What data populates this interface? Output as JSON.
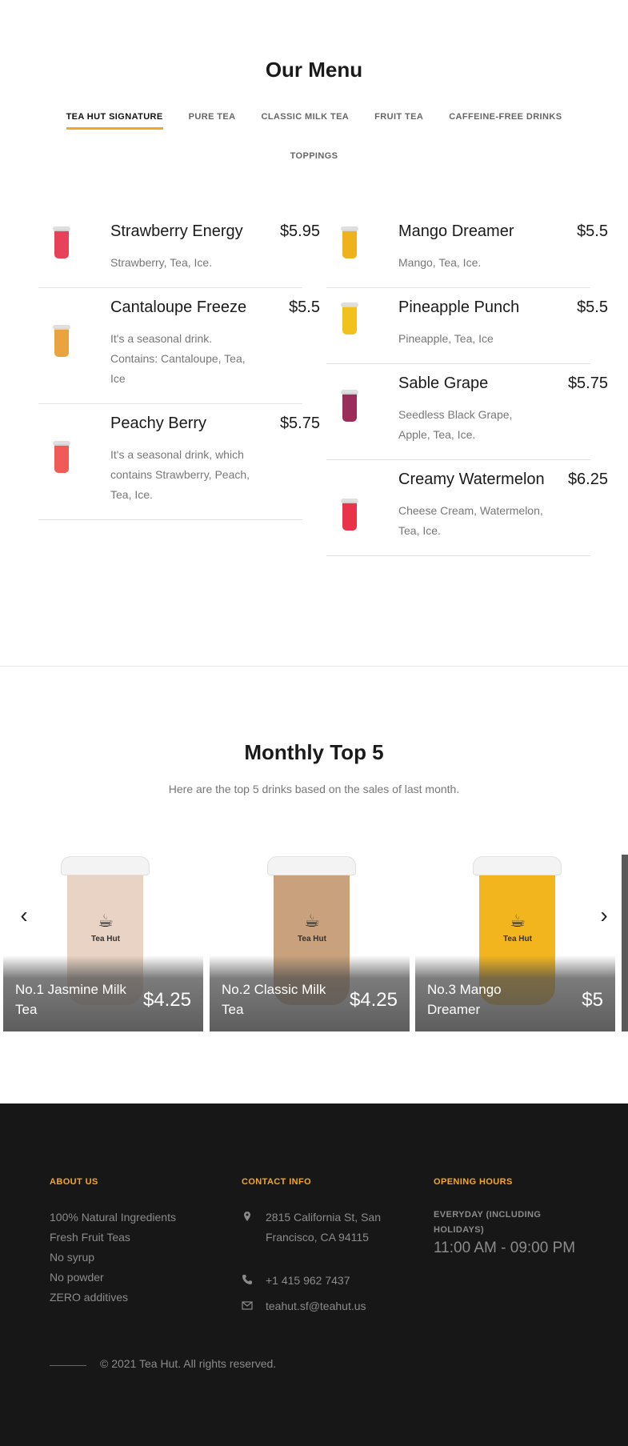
{
  "menu": {
    "title": "Our Menu",
    "tabs": [
      {
        "label": "TEA HUT SIGNATURE",
        "active": true
      },
      {
        "label": "PURE TEA"
      },
      {
        "label": "CLASSIC MILK TEA"
      },
      {
        "label": "FRUIT TEA"
      },
      {
        "label": "CAFFEINE-FREE DRINKS"
      },
      {
        "label": "TOPPINGS"
      }
    ],
    "left": [
      {
        "name": "Strawberry Energy",
        "price": "$5.95",
        "desc": "Strawberry, Tea, Ice.",
        "color": "#e8425a"
      },
      {
        "name": "Cantaloupe Freeze",
        "price": "$5.5",
        "desc": "It's a seasonal drink. Contains: Cantaloupe, Tea, Ice",
        "color": "#e9a33f"
      },
      {
        "name": "Peachy Berry",
        "price": "$5.75",
        "desc": "It's a seasonal drink, which contains Strawberry, Peach, Tea, Ice.",
        "color": "#f05a57"
      }
    ],
    "right": [
      {
        "name": "Mango Dreamer",
        "price": "$5.5",
        "desc": "Mango, Tea, Ice.",
        "color": "#f0b21a"
      },
      {
        "name": "Pineapple Punch",
        "price": "$5.5",
        "desc": "Pineapple, Tea, Ice",
        "color": "#f2c21c"
      },
      {
        "name": "Sable Grape",
        "price": "$5.75",
        "desc": "Seedless Black Grape, Apple, Tea, Ice.",
        "color": "#9b2d5a"
      },
      {
        "name": "Creamy Watermelon",
        "price": "$6.25",
        "desc": "Cheese Cream, Watermelon, Tea, Ice.",
        "color": "#e83348"
      }
    ]
  },
  "top5": {
    "title": "Monthly Top 5",
    "subtitle": "Here are the top 5 drinks based on the sales of last month.",
    "cards": [
      {
        "name": "No.1 Jasmine Milk Tea",
        "price": "$4.25",
        "color": "#e9d3c4"
      },
      {
        "name": "No.2 Classic Milk Tea",
        "price": "$4.25",
        "color": "#c9a27d"
      },
      {
        "name": "No.3 Mango Dreamer",
        "price": "$5",
        "color": "#f2b51d"
      }
    ],
    "prev_icon": "chevron-left-icon",
    "next_icon": "chevron-right-icon"
  },
  "footer": {
    "about": {
      "heading": "ABOUT US",
      "items": [
        "100% Natural Ingredients",
        "Fresh Fruit Teas",
        "No syrup",
        "No powder",
        "ZERO additives"
      ]
    },
    "contact": {
      "heading": "CONTACT INFO",
      "address": "2815 California St, San Francisco, CA 94115",
      "phone": "+1 415 962 7437",
      "email": "teahut.sf@teahut.us"
    },
    "hours": {
      "heading": "OPENING HOURS",
      "label": "EVERYDAY (INCLUDING HOLIDAYS)",
      "time": "11:00 AM - 09:00 PM"
    },
    "copyright": "© 2021 Tea Hut. All rights reserved."
  },
  "colors": {
    "accent": "#f5a623",
    "footer_bg": "#171717"
  }
}
